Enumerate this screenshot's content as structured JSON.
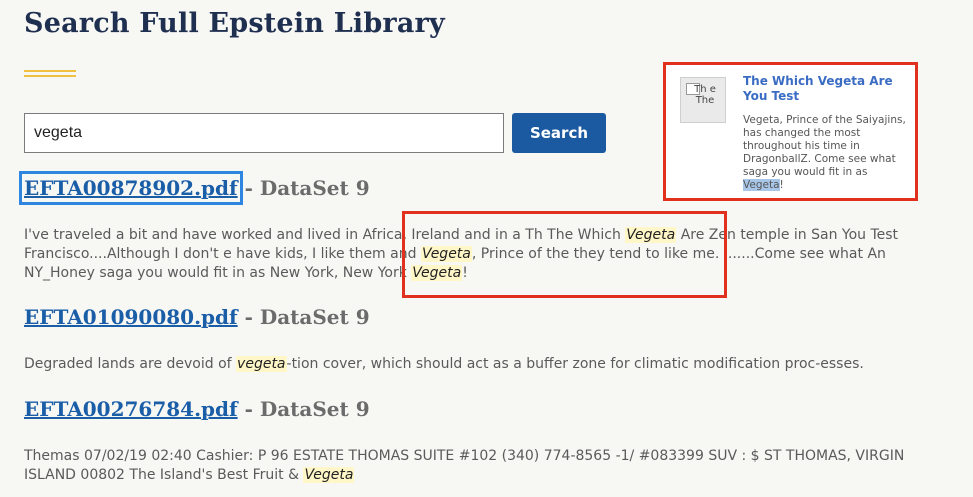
{
  "page": {
    "title": "Search Full Epstein Library"
  },
  "search": {
    "value": "vegeta",
    "button_label": "Search"
  },
  "results": [
    {
      "file": "EFTA00878902.pdf",
      "dataset": "- DataSet 9",
      "snippet_lines": [
        [
          "I've traveled a bit and have worked and lived in Africa, Ireland and in a Th The Which ",
          "Vegeta",
          " Are Zen temple in San You Test"
        ],
        [
          "Francisco....Although I don't e have kids, I like them and ",
          "Vegeta",
          ", Prince of the they tend to like me. I......Come see what An"
        ],
        [
          "NY_Honey saga you would fit in as New York, New York ",
          "Vegeta",
          "!"
        ]
      ]
    },
    {
      "file": "EFTA01090080.pdf",
      "dataset": "- DataSet 9",
      "snippet_lines": [
        [
          "Degraded lands are devoid of ",
          "vegeta",
          "-tion cover, which should act as a buffer zone for climatic modification proc-esses."
        ]
      ]
    },
    {
      "file": "EFTA00276784.pdf",
      "dataset": "- DataSet 9",
      "snippet_lines": [
        [
          "Themas 07/02/19 02:40 Cashier: P 96 ESTATE THOMAS SUITE #102 (340) 774-8565 -1/ #083399 SUV : $ ST THOMAS, VIRGIN",
          "",
          ""
        ],
        [
          "ISLAND 00802 The Island's Best Fruit & ",
          "Vegeta",
          ""
        ]
      ]
    }
  ],
  "ad_card": {
    "thumb_alt": "Th e The",
    "title": "The Which Vegeta Are You Test",
    "body": "Vegeta, Prince of the Saiyajins, has changed the most throughout his time in DragonballZ. Come see what saga you would fit in as ",
    "body_highlight": "Vegeta",
    "body_end": "!"
  },
  "colors": {
    "title": "#1f2f4f",
    "link": "#1a5ea8",
    "button": "#1b5aa0",
    "highlight": "#fff7c8",
    "annotation": "#e0301e",
    "focus": "#2f86e0"
  }
}
